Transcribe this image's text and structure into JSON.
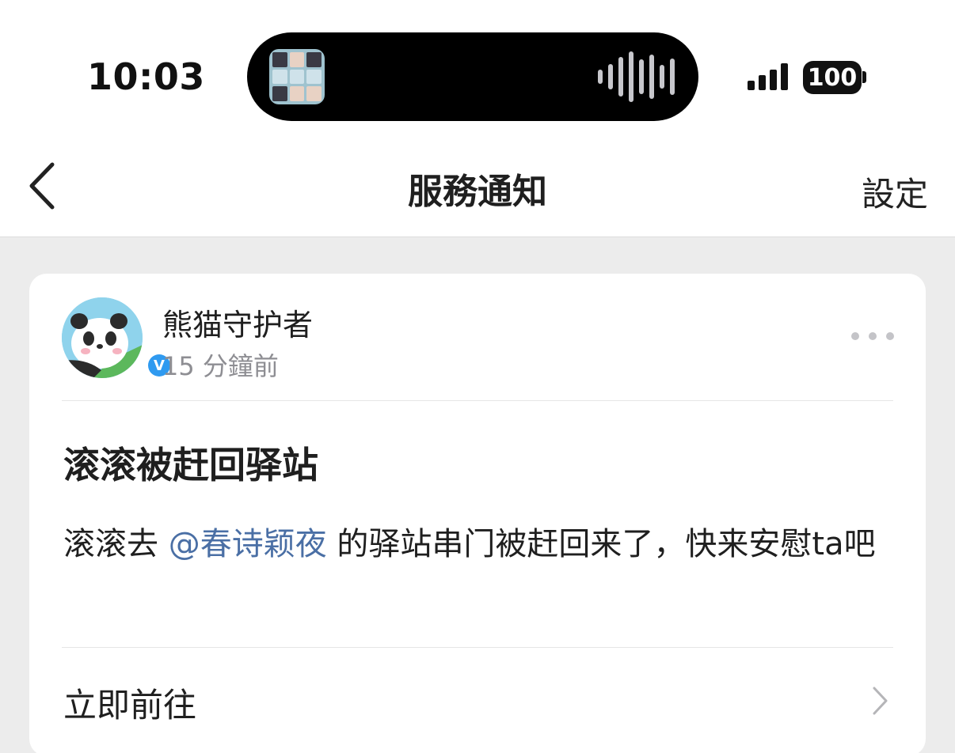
{
  "status_bar": {
    "time": "10:03",
    "battery": "100",
    "signal_bars": 4
  },
  "nav": {
    "title": "服務通知",
    "settings_label": "設定"
  },
  "notification": {
    "sender_name": "熊猫守护者",
    "time_ago": "15 分鐘前",
    "verified_badge": "V",
    "title": "滚滚被赶回驿站",
    "body_prefix": "滚滚去 ",
    "mention": "@春诗颖夜",
    "body_suffix": " 的驿站串门被赶回来了，快来安慰ta吧",
    "action_label": "立即前往"
  },
  "colors": {
    "accent_link": "#4a6fa5",
    "verified_blue": "#2f9af0",
    "page_background": "#ececec"
  },
  "icons": [
    "back-chevron-icon",
    "more-dots-icon",
    "chevron-right-icon",
    "verified-icon",
    "waveform-icon",
    "signal-icon",
    "battery-icon"
  ]
}
